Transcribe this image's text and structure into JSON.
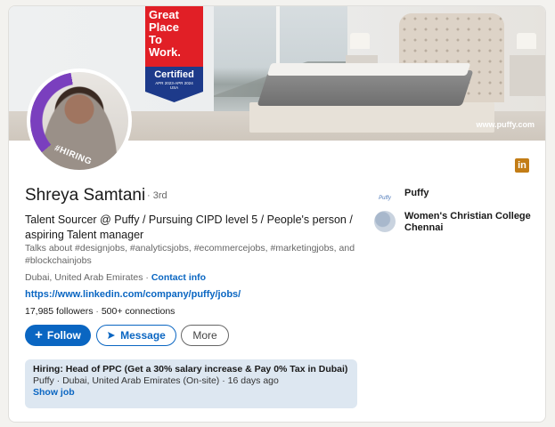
{
  "badge": {
    "lines": [
      "Great",
      "Place",
      "To",
      "Work."
    ],
    "certified": "Certified",
    "dates": "APR 2023-APR 2024",
    "country": "USA"
  },
  "banner": {
    "url": "www.puffy.com"
  },
  "avatar": {
    "frame_text": "#HIRING"
  },
  "profile": {
    "name": "Shreya Samtani",
    "degree": "· 3rd",
    "headline": "Talent Sourcer @ Puffy / Pursuing CIPD level 5 / People's person / aspiring Talent manager",
    "talks_about": "Talks about #designjobs, #analyticsjobs, #ecommercejobs, #marketingjobs, and #blockchainjobs",
    "location": "Dubai, United Arab Emirates",
    "location_sep": " · ",
    "contact_label": "Contact info",
    "website": "https://www.linkedin.com/company/puffy/jobs/",
    "followers": "17,985 followers",
    "connections": "500+ connections",
    "stat_sep": " · "
  },
  "actions": {
    "follow": "Follow",
    "message": "Message",
    "more": "More"
  },
  "job": {
    "title": "Hiring: Head of PPC (Get a 30% salary increase & Pay 0% Tax in Dubai)",
    "meta": "Puffy · Dubai, United Arab Emirates (On-site) · 16 days ago",
    "show": "Show job"
  },
  "companies": [
    {
      "name": "Puffy",
      "logo_text": "Puffy"
    },
    {
      "name": "Women's Christian College Chennai"
    }
  ],
  "icons": {
    "linkedin": "linkedin-icon"
  },
  "colors": {
    "accent": "#0a66c2",
    "gptw_red": "#e11f26",
    "gptw_blue": "#1d3a8a",
    "hiring_purple": "#7a3fbe",
    "job_bg": "#dde7f1"
  }
}
